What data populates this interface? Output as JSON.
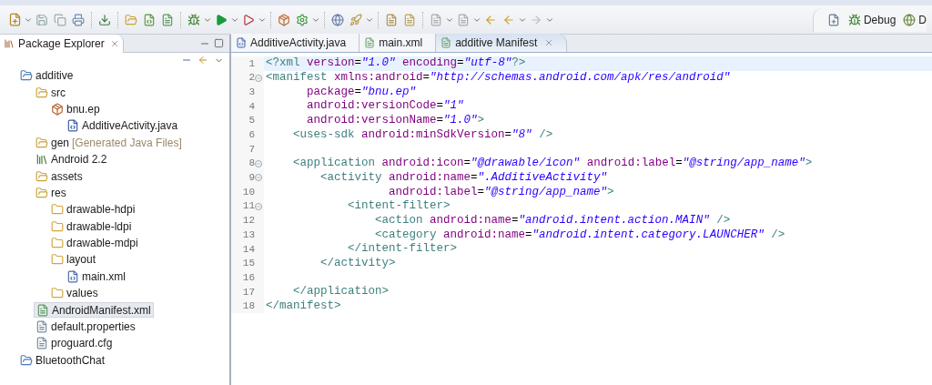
{
  "perspectives": [
    {
      "label": "Debug",
      "kind": "debug"
    },
    {
      "label": "D",
      "kind": "ddms"
    }
  ],
  "explorer": {
    "title": "Package Explorer",
    "tree": [
      {
        "label": "additive",
        "kind": "project",
        "selected": false,
        "children": [
          {
            "label": "src",
            "kind": "srcfolder",
            "selected": false,
            "children": [
              {
                "label": "bnu.ep",
                "kind": "package",
                "selected": false,
                "children": [
                  {
                    "label": "AdditiveActivity.java",
                    "kind": "java",
                    "selected": false
                  }
                ]
              }
            ]
          },
          {
            "label": "gen",
            "decoration": "[Generated Java Files]",
            "kind": "srcfolder",
            "selected": false
          },
          {
            "label": "Android 2.2",
            "kind": "library",
            "selected": false
          },
          {
            "label": "assets",
            "kind": "srcfolder",
            "selected": false
          },
          {
            "label": "res",
            "kind": "srcfolder",
            "selected": false,
            "children": [
              {
                "label": "drawable-hdpi",
                "kind": "folder",
                "selected": false
              },
              {
                "label": "drawable-ldpi",
                "kind": "folder",
                "selected": false
              },
              {
                "label": "drawable-mdpi",
                "kind": "folder",
                "selected": false
              },
              {
                "label": "layout",
                "kind": "folder",
                "selected": false,
                "children": [
                  {
                    "label": "main.xml",
                    "kind": "xml",
                    "selected": false
                  }
                ]
              },
              {
                "label": "values",
                "kind": "folder",
                "selected": false
              }
            ]
          },
          {
            "label": "AndroidManifest.xml",
            "kind": "manifest",
            "selected": true
          },
          {
            "label": "default.properties",
            "kind": "file",
            "selected": false
          },
          {
            "label": "proguard.cfg",
            "kind": "file",
            "selected": false
          }
        ]
      },
      {
        "label": "BluetoothChat",
        "kind": "project",
        "selected": false
      }
    ]
  },
  "editor": {
    "tabs": [
      {
        "label": "AdditiveActivity.java",
        "kind": "java",
        "selected": false
      },
      {
        "label": "main.xml",
        "kind": "manifest",
        "selected": false
      },
      {
        "label": "additive Manifest",
        "kind": "manifest",
        "selected": true
      }
    ],
    "lines": [
      {
        "number": "1",
        "fold": false,
        "current": true,
        "text": "<?xml version=\"1.0\" encoding=\"utf-8\"?>"
      },
      {
        "number": "2",
        "fold": true,
        "current": false,
        "text": "<manifest xmlns:android=\"http://schemas.android.com/apk/res/android\""
      },
      {
        "number": "3",
        "fold": false,
        "current": false,
        "text": "      package=\"bnu.ep\""
      },
      {
        "number": "4",
        "fold": false,
        "current": false,
        "text": "      android:versionCode=\"1\""
      },
      {
        "number": "5",
        "fold": false,
        "current": false,
        "text": "      android:versionName=\"1.0\">"
      },
      {
        "number": "6",
        "fold": false,
        "current": false,
        "text": "    <uses-sdk android:minSdkVersion=\"8\" />"
      },
      {
        "number": "7",
        "fold": false,
        "current": false
      },
      {
        "number": "8",
        "fold": true,
        "current": false,
        "text": "    <application android:icon=\"@drawable/icon\" android:label=\"@string/app_name\">"
      },
      {
        "number": "9",
        "fold": true,
        "current": false,
        "text": "        <activity android:name=\".AdditiveActivity\""
      },
      {
        "number": "10",
        "fold": false,
        "current": false,
        "text": "                  android:label=\"@string/app_name\">"
      },
      {
        "number": "11",
        "fold": true,
        "current": false,
        "text": "            <intent-filter>"
      },
      {
        "number": "12",
        "fold": false,
        "current": false,
        "text": "                <action android:name=\"android.intent.action.MAIN\" />"
      },
      {
        "number": "13",
        "fold": false,
        "current": false,
        "text": "                <category android:name=\"android.intent.category.LAUNCHER\" />"
      },
      {
        "number": "14",
        "fold": false,
        "current": false,
        "text": "            </intent-filter>"
      },
      {
        "number": "15",
        "fold": false,
        "current": false,
        "text": "        </activity>"
      },
      {
        "number": "16",
        "fold": false,
        "current": false
      },
      {
        "number": "17",
        "fold": false,
        "current": false,
        "text": "    </application>"
      },
      {
        "number": "18",
        "fold": false,
        "current": false,
        "text": "</manifest>"
      }
    ]
  }
}
